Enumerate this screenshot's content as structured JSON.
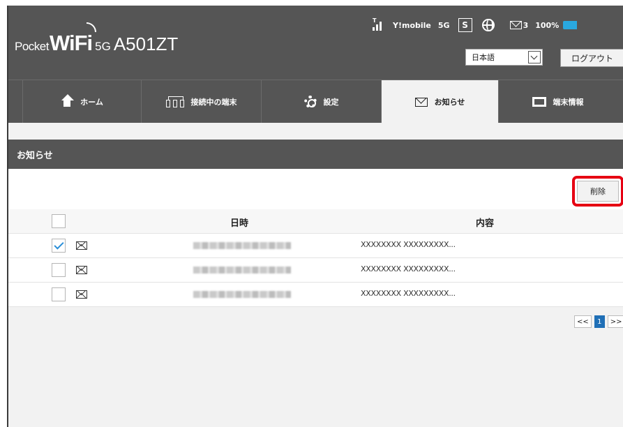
{
  "header": {
    "logo": {
      "pocket": "Pocket",
      "wifi": "WiFi",
      "fiveg": "5G",
      "model": "A501ZT"
    },
    "status": {
      "carrier": "Y!mobile",
      "network": "5G",
      "sim": "S",
      "mail_count": "3",
      "battery": "100%"
    },
    "language": {
      "selected": "日本語"
    },
    "logout_label": "ログアウト"
  },
  "nav": {
    "tabs": [
      {
        "label": "ホーム",
        "icon": "home-icon",
        "active": false
      },
      {
        "label": "接続中の端末",
        "icon": "devices-icon",
        "active": false
      },
      {
        "label": "設定",
        "icon": "gear-icon",
        "active": false
      },
      {
        "label": "お知らせ",
        "icon": "mail-icon",
        "active": true
      },
      {
        "label": "端末情報",
        "icon": "screen-icon",
        "active": false
      }
    ]
  },
  "section": {
    "title": "お知らせ"
  },
  "toolbar": {
    "delete_label": "削除"
  },
  "table": {
    "headers": {
      "date": "日時",
      "content": "内容"
    },
    "rows": [
      {
        "checked": true,
        "content": "XXXXXXXX XXXXXXXXX..."
      },
      {
        "checked": false,
        "content": "XXXXXXXX XXXXXXXXX..."
      },
      {
        "checked": false,
        "content": "XXXXXXXX XXXXXXXXX..."
      }
    ]
  },
  "pagination": {
    "prev": "<<",
    "current": "1",
    "next": ">>"
  },
  "colors": {
    "header_bg": "#555555",
    "highlight": "#e60012",
    "accent": "#1f6fb6",
    "battery": "#29a8e0"
  }
}
